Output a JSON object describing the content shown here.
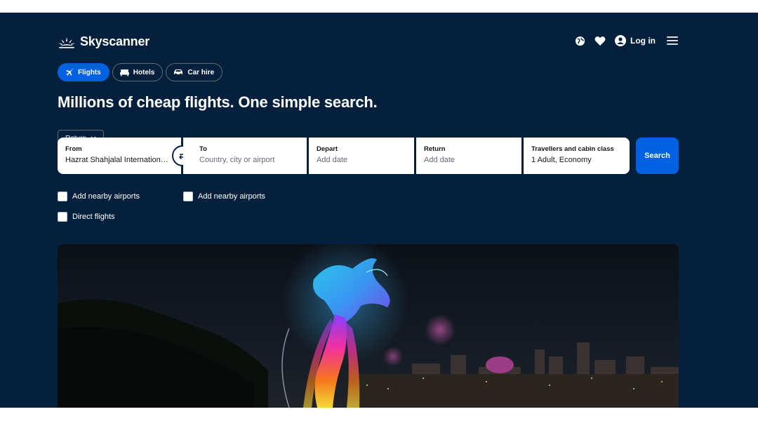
{
  "brand": {
    "name": "Skyscanner"
  },
  "header": {
    "login_label": "Log in",
    "icons": [
      "globe-icon",
      "heart-icon",
      "user-icon",
      "menu-icon"
    ]
  },
  "tabs": [
    {
      "label": "Flights",
      "icon": "plane-icon",
      "active": true
    },
    {
      "label": "Hotels",
      "icon": "bed-icon",
      "active": false
    },
    {
      "label": "Car hire",
      "icon": "car-icon",
      "active": false
    }
  ],
  "headline": "Millions of cheap flights. One simple search.",
  "trip_type": {
    "selected": "Return"
  },
  "search": {
    "from": {
      "label": "From",
      "value": "Hazrat Shahjalal International..."
    },
    "to": {
      "label": "To",
      "placeholder": "Country, city or airport"
    },
    "depart": {
      "label": "Depart",
      "placeholder": "Add date"
    },
    "return": {
      "label": "Return",
      "placeholder": "Add date"
    },
    "travellers": {
      "label": "Travellers and cabin class",
      "value": "1 Adult, Economy"
    },
    "button_label": "Search"
  },
  "options": {
    "nearby_from": "Add nearby airports",
    "nearby_to": "Add nearby airports",
    "direct": "Direct flights"
  },
  "colors": {
    "background": "#05203c",
    "accent": "#0062e3",
    "text": "#ffffff"
  }
}
